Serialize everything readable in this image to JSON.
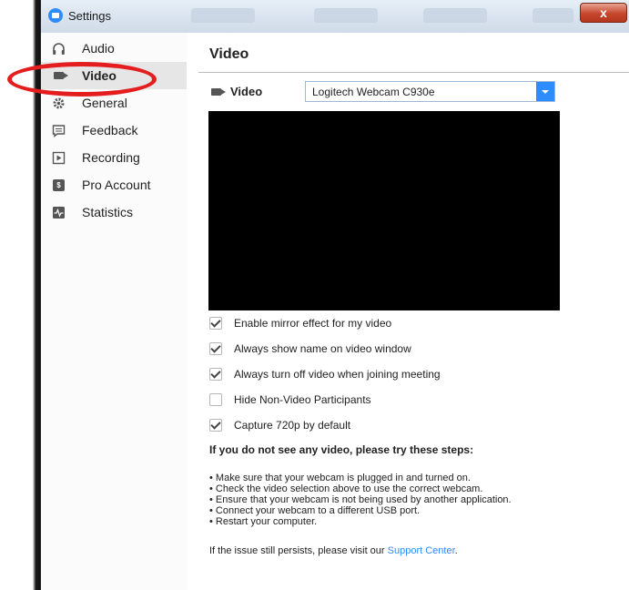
{
  "window": {
    "title": "Settings",
    "close_glyph": "x",
    "accent": "#2d8cff",
    "annotation_color": "#e41e1e"
  },
  "sidebar": {
    "items": [
      {
        "label": "Audio",
        "icon": "headphones-icon"
      },
      {
        "label": "Video",
        "icon": "camera-icon",
        "active": true
      },
      {
        "label": "General",
        "icon": "gear-icon"
      },
      {
        "label": "Feedback",
        "icon": "chat-icon"
      },
      {
        "label": "Recording",
        "icon": "record-icon"
      },
      {
        "label": "Pro Account",
        "icon": "pro-account-icon"
      },
      {
        "label": "Statistics",
        "icon": "statistics-icon"
      }
    ]
  },
  "main": {
    "title": "Video",
    "camera_label": "Video",
    "camera_value": "Logitech Webcam C930e",
    "options": [
      {
        "label": "Enable mirror effect for my video",
        "checked": true
      },
      {
        "label": "Always show name on video window",
        "checked": true
      },
      {
        "label": "Always turn off video when joining meeting",
        "checked": true
      },
      {
        "label": "Hide Non-Video Participants",
        "checked": false
      },
      {
        "label": "Capture 720p by default",
        "checked": true
      }
    ],
    "help_heading": "If you do not see any video, please try these steps:",
    "help_steps": [
      "• Make sure that your webcam is plugged in and turned on.",
      "• Check the video selection above to use the correct webcam.",
      "• Ensure that your webcam is not being used by another application.",
      "• Connect your webcam to a different USB port.",
      "• Restart your computer."
    ],
    "help_footer_prefix": "If the issue still persists, please visit our ",
    "support_link": "Support Center",
    "help_footer_suffix": "."
  }
}
